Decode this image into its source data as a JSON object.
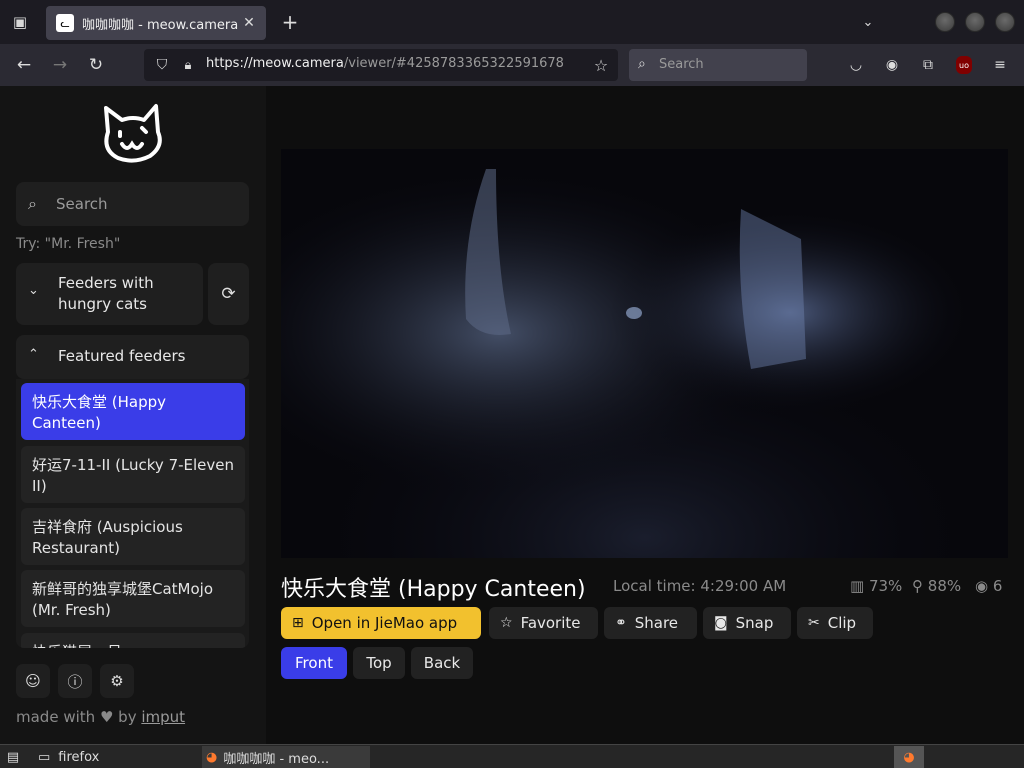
{
  "browser": {
    "tab_title": "咖咖咖咖 - meow.camera",
    "url_host": "https://meow.camera",
    "url_path": "/viewer/#4258783365322591678",
    "search_placeholder": "Search"
  },
  "sidebar": {
    "search_placeholder": "Search",
    "try_hint": "Try: \"Mr. Fresh\"",
    "hungry_label": "Feeders with hungry cats",
    "featured_label": "Featured feeders",
    "feeders": [
      {
        "label": "快乐大食堂 (Happy Canteen)"
      },
      {
        "label": "好运7-11-II (Lucky 7-Eleven II)"
      },
      {
        "label": "吉祥食府 (Auspicious Restaurant)"
      },
      {
        "label": "新鲜哥的独享城堡CatMojo (Mr. Fresh)"
      },
      {
        "label": "快乐猫屋一号"
      }
    ],
    "made_with": "made with",
    "by": "by",
    "author": "imput"
  },
  "main": {
    "title": "快乐大食堂 (Happy Canteen)",
    "local_time": "Local time: 4:29:00 AM",
    "stats": {
      "food": "73%",
      "signal": "88%",
      "viewers": "6"
    },
    "actions": {
      "open_app": "Open in JieMao app",
      "favorite": "Favorite",
      "share": "Share",
      "snap": "Snap",
      "clip": "Clip"
    },
    "views": {
      "front": "Front",
      "top": "Top",
      "back": "Back"
    }
  },
  "taskbar": {
    "folder_label": "firefox",
    "window_label": "咖咖咖咖 - meo..."
  },
  "colors": {
    "accent": "#3a3de8",
    "open_app": "#f2c12e",
    "sidebar_bg": "#141414",
    "page_bg": "#0e0e0e"
  }
}
